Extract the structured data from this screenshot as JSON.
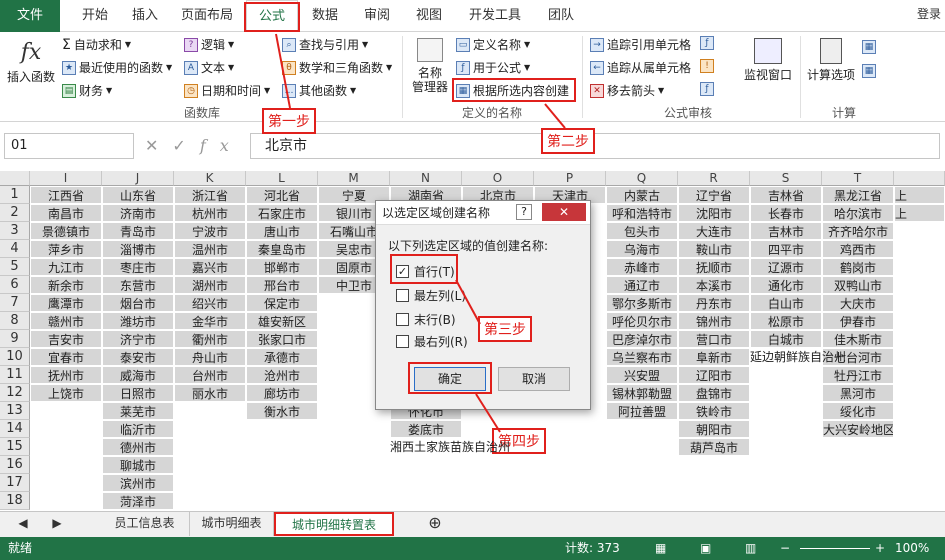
{
  "tabs": [
    "文件",
    "开始",
    "插入",
    "页面布局",
    "公式",
    "数据",
    "审阅",
    "视图",
    "开发工具",
    "团队"
  ],
  "login": "登录",
  "ribbon": {
    "insert_fn": "插入函数",
    "autosum": "自动求和",
    "recent": "最近使用的函数",
    "finance": "财务",
    "logic": "逻辑",
    "text": "文本",
    "datetime": "日期和时间",
    "lookup": "查找与引用",
    "math": "数学和三角函数",
    "other": "其他函数",
    "lib_label": "函数库",
    "name_mgr": "名称\n管理器",
    "define_name": "定义名称",
    "use_in_formula": "用于公式",
    "create_from_sel": "根据所选内容创建",
    "names_label": "定义的名称",
    "trace_prec": "追踪引用单元格",
    "trace_dep": "追踪从属单元格",
    "remove_arrows": "移去箭头",
    "audit_label": "公式审核",
    "watch": "监视窗口",
    "calc_opts": "计算选项",
    "calc_label": "计算"
  },
  "namebox": "01",
  "formula": "北京市",
  "col_headers": [
    "I",
    "J",
    "K",
    "L",
    "M",
    "N",
    "O",
    "P",
    "Q",
    "R",
    "S",
    "T"
  ],
  "rows": [
    "1",
    "2",
    "3",
    "4",
    "5",
    "6",
    "7",
    "8",
    "9",
    "10",
    "11",
    "12",
    "13",
    "14",
    "15",
    "16",
    "17",
    "18"
  ],
  "columns": [
    [
      "江西省",
      "南昌市",
      "景德镇市",
      "萍乡市",
      "九江市",
      "新余市",
      "鹰潭市",
      "赣州市",
      "吉安市",
      "宜春市",
      "抚州市",
      "上饶市"
    ],
    [
      "山东省",
      "济南市",
      "青岛市",
      "淄博市",
      "枣庄市",
      "东营市",
      "烟台市",
      "潍坊市",
      "济宁市",
      "泰安市",
      "威海市",
      "日照市",
      "莱芜市",
      "临沂市",
      "德州市",
      "聊城市",
      "滨州市",
      "菏泽市"
    ],
    [
      "浙江省",
      "杭州市",
      "宁波市",
      "温州市",
      "嘉兴市",
      "湖州市",
      "绍兴市",
      "金华市",
      "衢州市",
      "舟山市",
      "台州市",
      "丽水市"
    ],
    [
      "河北省",
      "石家庄市",
      "唐山市",
      "秦皇岛市",
      "邯郸市",
      "邢台市",
      "保定市",
      "雄安新区",
      "张家口市",
      "承德市",
      "沧州市",
      "廊坊市",
      "衡水市"
    ],
    [
      "宁夏",
      "银川市",
      "石嘴山市",
      "吴忠市",
      "固原市",
      "中卫市"
    ],
    [
      "湖南省",
      "",
      "",
      "",
      "",
      "",
      "",
      "",
      "",
      "",
      "",
      "",
      "怀化市",
      "娄底市",
      "湘西土家族苗族自治州"
    ],
    [
      "北京市"
    ],
    [
      "天津市"
    ],
    [
      "内蒙古",
      "呼和浩特市",
      "包头市",
      "乌海市",
      "赤峰市",
      "通辽市",
      "鄂尔多斯市",
      "呼伦贝尔市",
      "巴彦淖尔市",
      "乌兰察布市",
      "兴安盟",
      "锡林郭勒盟",
      "阿拉善盟"
    ],
    [
      "辽宁省",
      "沈阳市",
      "大连市",
      "鞍山市",
      "抚顺市",
      "本溪市",
      "丹东市",
      "锦州市",
      "营口市",
      "阜新市",
      "辽阳市",
      "盘锦市",
      "铁岭市",
      "朝阳市",
      "葫芦岛市"
    ],
    [
      "吉林省",
      "长春市",
      "吉林市",
      "四平市",
      "辽源市",
      "通化市",
      "白山市",
      "松原市",
      "白城市",
      "延边朝鲜族自治州"
    ],
    [
      "黑龙江省",
      "哈尔滨市",
      "齐齐哈尔市",
      "鸡西市",
      "鹤岗市",
      "双鸭山市",
      "大庆市",
      "伊春市",
      "佳木斯市",
      "七台河市",
      "牡丹江市",
      "黑河市",
      "绥化市",
      "大兴安岭地区"
    ]
  ],
  "extra_col": [
    "上",
    "上"
  ],
  "dialog": {
    "title": "以选定区域创建名称",
    "help": "?",
    "close": "✕",
    "prompt": "以下列选定区域的值创建名称:",
    "options": [
      {
        "label": "首行(T)",
        "checked": true
      },
      {
        "label": "最左列(L)",
        "checked": false
      },
      {
        "label": "末行(B)",
        "checked": false
      },
      {
        "label": "最右列(R)",
        "checked": false
      }
    ],
    "ok": "确定",
    "cancel": "取消"
  },
  "annotations": [
    "第一步",
    "第二步",
    "第三步",
    "第四步"
  ],
  "sheets": [
    "员工信息表",
    "城市明细表",
    "城市明细转置表"
  ],
  "status": {
    "ready": "就绪",
    "count": "计数: 373",
    "zoom": "100%"
  },
  "colors": {
    "excel_green": "#217346",
    "annotation_red": "#e0201c"
  }
}
